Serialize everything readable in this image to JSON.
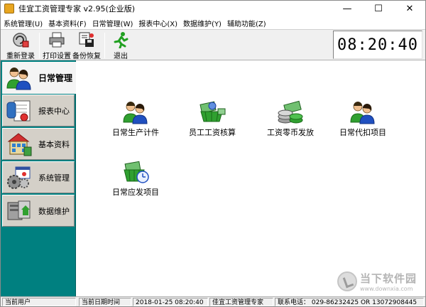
{
  "window": {
    "title": "佳宜工资管理专家  v2.95(企业版)",
    "controls": {
      "minimize": "—",
      "maximize": "☐",
      "close": "✕"
    }
  },
  "menu": [
    {
      "label": "系统管理(U)"
    },
    {
      "label": "基本资料(F)"
    },
    {
      "label": "日常管理(W)"
    },
    {
      "label": "报表中心(X)"
    },
    {
      "label": "数据维护(Y)"
    },
    {
      "label": "辅助功能(Z)"
    }
  ],
  "toolbar": {
    "relogin": "重新登录",
    "print_setup": "打印设置",
    "backup_restore": "备份恢复",
    "exit": "退出"
  },
  "clock": "08:20:40",
  "sidebar": [
    {
      "label": "日常管理",
      "icon": "people-icon",
      "active": true
    },
    {
      "label": "报表中心",
      "icon": "report-icon",
      "active": false
    },
    {
      "label": "基本资料",
      "icon": "building-icon",
      "active": false
    },
    {
      "label": "系统管理",
      "icon": "gears-icon",
      "active": false
    },
    {
      "label": "数据维护",
      "icon": "database-icon",
      "active": false
    }
  ],
  "tiles": [
    {
      "label": "日常生产计件",
      "icon": "people-icon"
    },
    {
      "label": "员工工资核算",
      "icon": "money-basket-icon"
    },
    {
      "label": "工资零币发放",
      "icon": "coins-icon"
    },
    {
      "label": "日常代扣项目",
      "icon": "people-icon"
    },
    {
      "label": "日常应发项目",
      "icon": "money-clock-icon"
    }
  ],
  "statusbar": {
    "user_label": "当前用户",
    "date_label": "当前日期时间",
    "datetime": "2018-01-25 08:20:40",
    "product": "佳宜工资管理专家",
    "contact": "联系电话：  029-86232425  OR  13072908445"
  },
  "watermark": {
    "title": "当下软件园",
    "url": "www.downxia.com"
  },
  "colors": {
    "sidebar_bg": "#008080",
    "content_bg": "#ffffff",
    "toolbar_bg": "#f0f0f0"
  }
}
